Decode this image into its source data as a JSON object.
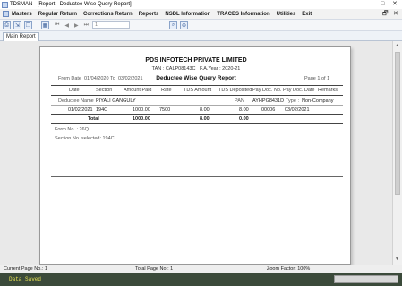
{
  "window": {
    "title": "TDSMAN - [Report - Deductee Wise Query Report]",
    "controls": [
      "–",
      "□",
      "✕"
    ]
  },
  "menu": {
    "items": [
      "Masters",
      "Regular Return",
      "Corrections Return",
      "Reports",
      "NSDL Information",
      "TRACES Information",
      "Utilities",
      "Exit"
    ],
    "mdi_controls": [
      "–",
      "🗗",
      "✕"
    ]
  },
  "toolbar": {
    "buttons": [
      "print-icon",
      "export-icon",
      "copy-icon",
      "calendar-icon"
    ],
    "nav": [
      "⏮",
      "◀",
      "▶",
      "⏭"
    ],
    "page_value": "1",
    "zoom_icons": [
      "search-icon",
      "zoom-icon"
    ]
  },
  "tabs": {
    "main_report": "Main Report"
  },
  "report": {
    "company": "PDS INFOTECH PRIVATE LIMITED",
    "tan_label": "TAN :",
    "tan": "CALP08143C",
    "fy_label": "F.A.Year :",
    "fy": "2020-21",
    "from_label": "From Date",
    "from_date": "01/04/2020",
    "to_label": "To",
    "to_date": "03/02/2021",
    "title": "Deductee Wise Query Report",
    "page_label": "Page 1 of 1",
    "columns": [
      "Date",
      "Section",
      "Amount Paid",
      "Rate",
      "TDS Amount",
      "TDS Deposited",
      "Pay Doc. No.",
      "Pay Doc. Date",
      "Remarks"
    ],
    "deductee_name_label": "Deductee Name",
    "deductee_name": "PIYALI GANGULY",
    "pan_label": "PAN",
    "pan": "AYHPG8431D",
    "type_label": "Type :",
    "type": "Non-Company",
    "row": {
      "date": "01/02/2021",
      "section": "194C",
      "amount_paid": "1000.00",
      "rate": "7500",
      "tds_amount": "8.00",
      "tds_deposited": "8.00",
      "pay_doc_no": "00006",
      "pay_doc_date": "03/02/2021"
    },
    "total_label": "Total",
    "total_amount": "1000.00",
    "total_tds": "8.00",
    "total_deposited": "0.00",
    "form_no": "Form No. : 26Q",
    "section_selected": "Section No. selected: 194C"
  },
  "status": {
    "current_page": "Current Page No.: 1",
    "total_page": "Total Page No.: 1",
    "zoom": "Zoom Factor: 100%"
  },
  "bottom": {
    "saved": "Data Saved"
  }
}
